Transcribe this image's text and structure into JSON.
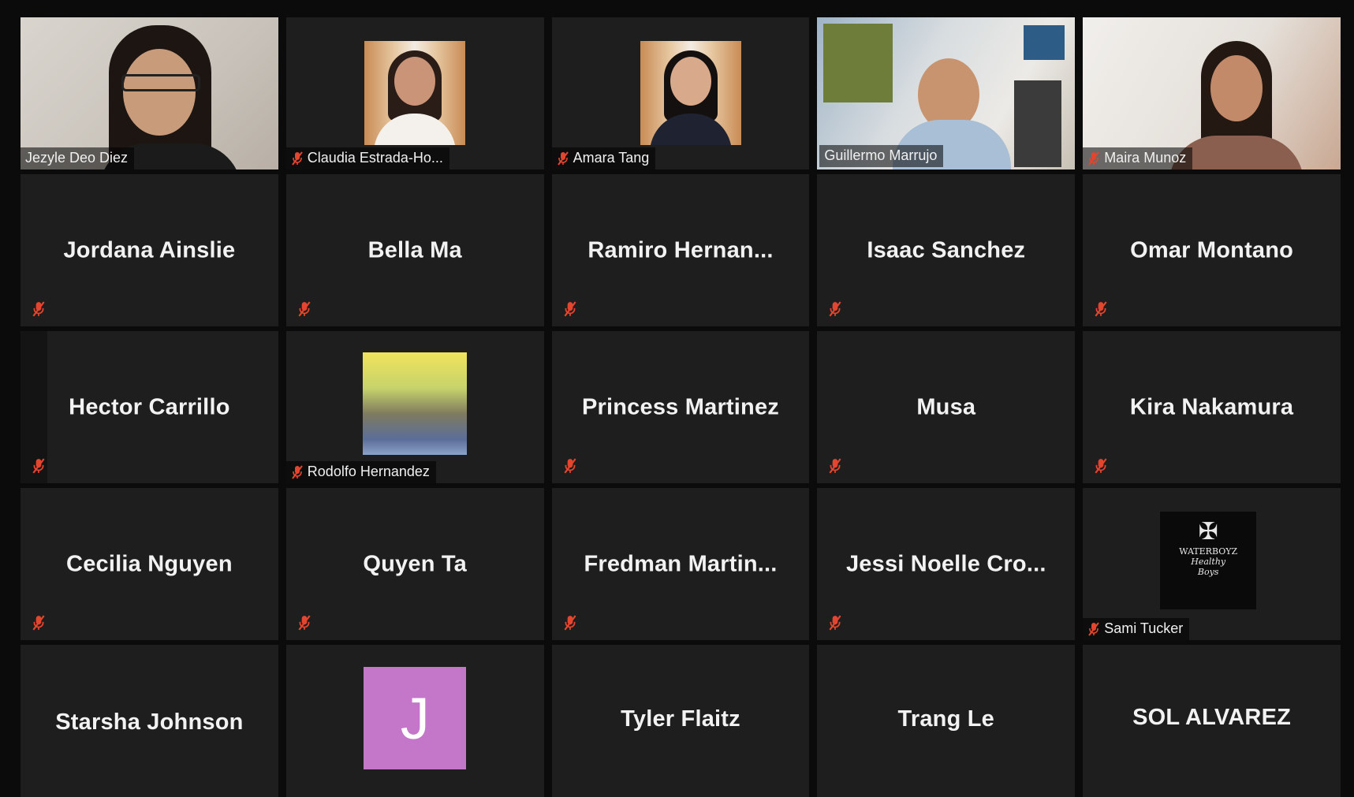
{
  "meeting": {
    "participants": [
      {
        "name": "Jezyle Deo Diez",
        "muted": false,
        "video": true
      },
      {
        "name": "Claudia Estrada-Ho...",
        "muted": true,
        "video": true
      },
      {
        "name": "Amara Tang",
        "muted": true,
        "video": true
      },
      {
        "name": "Guillermo Marrujo",
        "muted": false,
        "video": true,
        "active_speaker": true
      },
      {
        "name": "Maira Munoz",
        "muted": true,
        "video": true
      },
      {
        "name": "Jordana Ainslie",
        "muted": true,
        "video": false
      },
      {
        "name": "Bella Ma",
        "muted": true,
        "video": false
      },
      {
        "name": "Ramiro  Hernan...",
        "muted": true,
        "video": false
      },
      {
        "name": "Isaac Sanchez",
        "muted": true,
        "video": false
      },
      {
        "name": "Omar Montano",
        "muted": true,
        "video": false
      },
      {
        "name": "Hector Carrillo",
        "muted": true,
        "video": false
      },
      {
        "name": "Rodolfo Hernandez",
        "muted": true,
        "video": false,
        "profile_picture": true
      },
      {
        "name": "Princess Martinez",
        "muted": true,
        "video": false
      },
      {
        "name": "Musa",
        "muted": true,
        "video": false
      },
      {
        "name": "Kira Nakamura",
        "muted": true,
        "video": false
      },
      {
        "name": "Cecilia Nguyen",
        "muted": true,
        "video": false
      },
      {
        "name": "Quyen Ta",
        "muted": true,
        "video": false
      },
      {
        "name": "Fredman  Martin...",
        "muted": true,
        "video": false
      },
      {
        "name": "Jessi  Noelle  Cro...",
        "muted": true,
        "video": false
      },
      {
        "name": "Sami Tucker",
        "muted": true,
        "video": false,
        "profile_picture": true
      },
      {
        "name": "Starsha Johnson",
        "muted": false,
        "video": false
      },
      {
        "name": "J",
        "muted": false,
        "video": false,
        "avatar_letter": true
      },
      {
        "name": "Tyler Flaitz",
        "muted": false,
        "video": false
      },
      {
        "name": "Trang Le",
        "muted": false,
        "video": false
      },
      {
        "name": "SOL ALVAREZ",
        "muted": false,
        "video": false
      }
    ],
    "colors": {
      "active_speaker_border": "#d9e04a",
      "mute_icon": "#e3452e",
      "tile_background": "#1e1e1e",
      "avatar_letter_background": "#c476c8"
    },
    "logo_text": [
      "WATERBOYZ",
      "Healthy",
      "Boys"
    ]
  }
}
